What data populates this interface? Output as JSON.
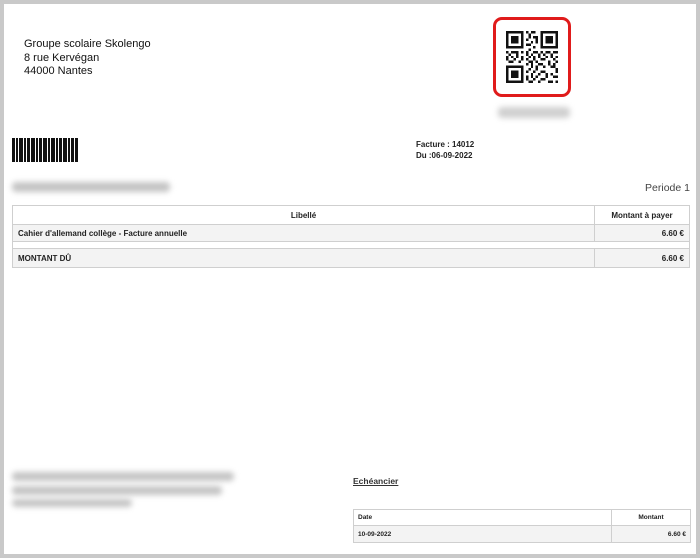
{
  "sender": {
    "name": "Groupe scolaire Skolengo",
    "street": "8 rue Kervégan",
    "city": "44000 Nantes"
  },
  "icons": {
    "qr": "qr-code-icon",
    "barcode": "barcode-icon"
  },
  "colors": {
    "highlight": "#e01b1b"
  },
  "invoice": {
    "number_line": "Facture : 14012",
    "date_line": "Du :06-09-2022"
  },
  "periode": "Periode 1",
  "items_table": {
    "headers": [
      "Libellé",
      "Montant à payer"
    ],
    "rows": [
      {
        "label": "Cahier d'allemand collège - Facture annuelle",
        "amount": "6.60 €"
      }
    ],
    "total": {
      "label": "MONTANT DÛ",
      "amount": "6.60 €"
    }
  },
  "echeancier": {
    "title": "Echéancier",
    "headers": [
      "Date",
      "Montant"
    ],
    "rows": [
      {
        "date": "10-09-2022",
        "amount": "6.60 €"
      }
    ]
  }
}
